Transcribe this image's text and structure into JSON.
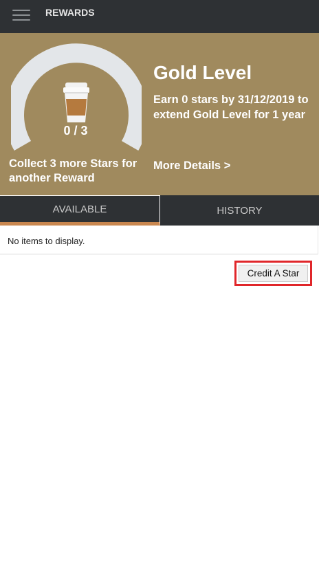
{
  "header": {
    "title": "REWARDS",
    "menu_icon": "hamburger-menu-icon"
  },
  "rewards": {
    "cup_icon": "coffee-cup-icon",
    "stars_collected": 0,
    "stars_needed": 3,
    "star_count_text": "0 / 3",
    "collect_text": "Collect 3 more Stars for another Reward",
    "level_title": "Gold Level",
    "level_desc": "Earn 0 stars by 31/12/2019 to extend Gold Level for 1 year",
    "more_details": "More Details >"
  },
  "tabs": [
    {
      "label": "AVAILABLE",
      "active": true
    },
    {
      "label": "HISTORY",
      "active": false
    }
  ],
  "list": {
    "empty_text": "No items to display."
  },
  "actions": {
    "credit_label": "Credit A Star"
  },
  "colors": {
    "header_bg": "#2e3134",
    "hero_bg": "#a08a5e",
    "tab_accent": "#c9874f",
    "highlight": "#e0262a",
    "gauge_track": "#e3e6e9"
  }
}
